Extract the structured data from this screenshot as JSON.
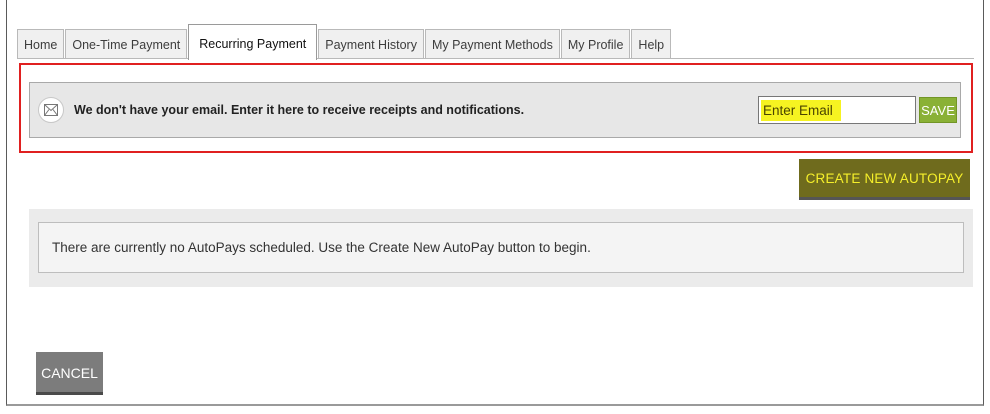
{
  "tabs": [
    {
      "label": "Home",
      "active": false
    },
    {
      "label": "One-Time Payment",
      "active": false
    },
    {
      "label": "Recurring Payment",
      "active": true
    },
    {
      "label": "Payment History",
      "active": false
    },
    {
      "label": "My Payment Methods",
      "active": false
    },
    {
      "label": "My Profile",
      "active": false
    },
    {
      "label": "Help",
      "active": false
    }
  ],
  "email_notice": {
    "icon": "mail-icon",
    "message": "We don't have your email. Enter it here to receive receipts and notifications.",
    "input_placeholder": "Enter Email",
    "input_value": "",
    "save_label": "SAVE"
  },
  "autopay": {
    "create_label": "CREATE NEW AUTOPAY",
    "empty_message": "There are currently no AutoPays scheduled. Use the Create New AutoPay button to begin."
  },
  "footer": {
    "cancel_label": "CANCEL"
  },
  "colors": {
    "save_button": "#8ab136",
    "create_button": "#6f6b1d",
    "highlight": "#f6f321",
    "callout_border": "#e02020"
  }
}
